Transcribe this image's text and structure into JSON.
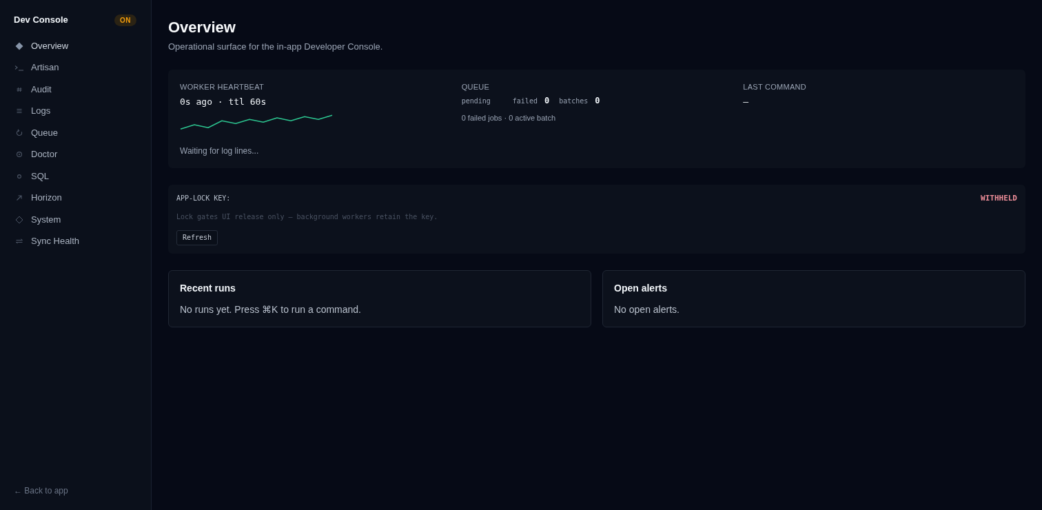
{
  "sidebar": {
    "title": "Dev Console",
    "badge": "ON",
    "items": [
      {
        "label": "Overview",
        "selected": true
      },
      {
        "label": "Artisan",
        "selected": false
      },
      {
        "label": "Audit",
        "selected": false
      },
      {
        "label": "Logs",
        "selected": false
      },
      {
        "label": "Queue",
        "selected": false
      },
      {
        "label": "Doctor",
        "selected": false
      },
      {
        "label": "SQL",
        "selected": false
      },
      {
        "label": "Horizon",
        "selected": false
      },
      {
        "label": "System",
        "selected": false
      },
      {
        "label": "Sync Health",
        "selected": false
      }
    ],
    "back_link": "← Back to app"
  },
  "page": {
    "title": "Overview",
    "subtitle": "Operational surface for the in-app Developer Console."
  },
  "status_card": {
    "heartbeat": {
      "label": "WORKER HEARTBEAT",
      "value": "0s ago · ttl 60s",
      "log_status": "Waiting for log lines..."
    },
    "queue": {
      "label": "QUEUE",
      "stats": [
        {
          "label": "pending"
        },
        {
          "label": "failed",
          "value": "0"
        },
        {
          "label": "batches",
          "value": "0"
        }
      ],
      "summary": "0 failed jobs · 0 active batch"
    },
    "last_command": {
      "label": "LAST COMMAND",
      "value": "—"
    }
  },
  "lock_card": {
    "label": "APP-LOCK KEY:",
    "status": "WITHHELD",
    "hint": "Lock gates UI release only — background workers retain the key.",
    "button": "Refresh"
  },
  "panels": [
    {
      "title": "Recent runs",
      "text": "No runs yet. Press ⌘K to run a command."
    },
    {
      "title": "Open alerts",
      "text": "No open alerts."
    }
  ]
}
